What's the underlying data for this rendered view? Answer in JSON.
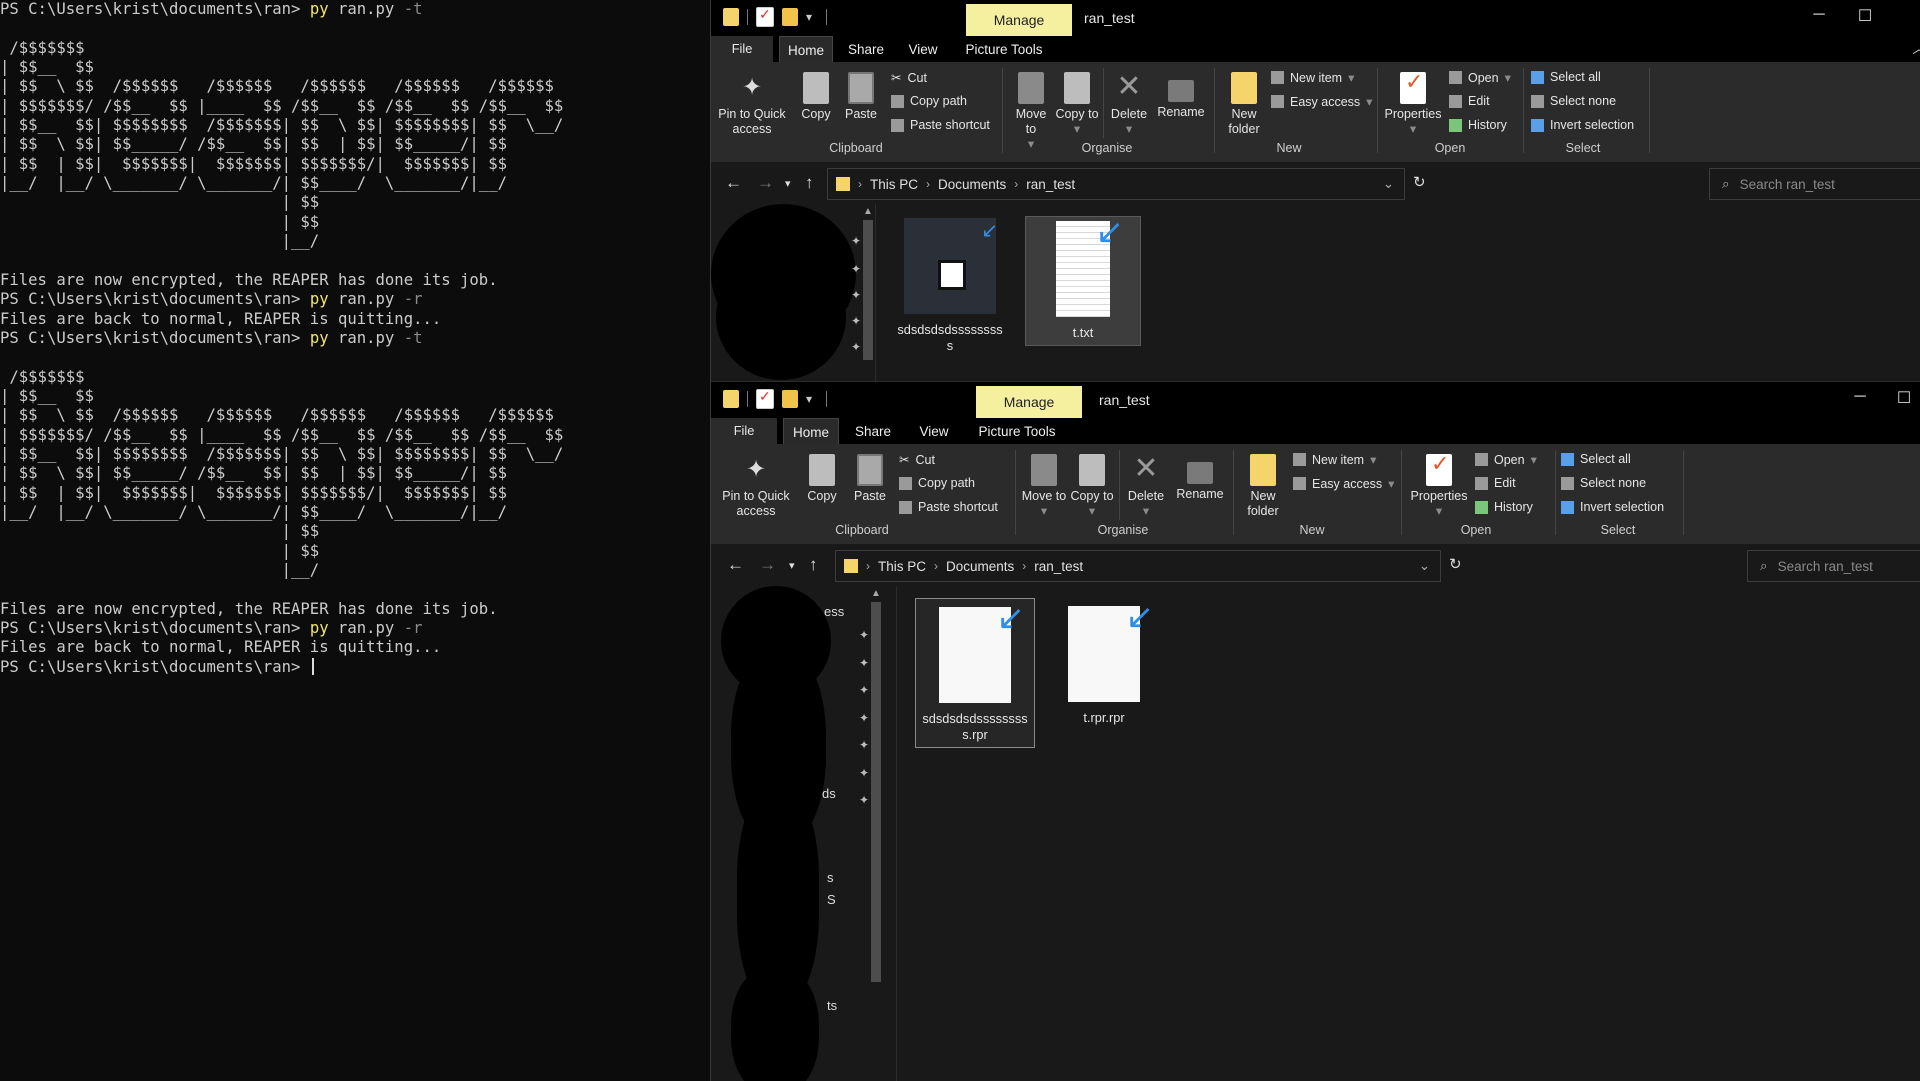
{
  "terminal": {
    "lines": [
      {
        "prompt": "PS C:\\Users\\krist\\documents\\ran> ",
        "cmd": "py",
        "args": " ran.py ",
        "flag": "-t"
      },
      {
        "text": ""
      },
      {
        "text": " /$$$$$$$"
      },
      {
        "text": "| $$__  $$"
      },
      {
        "text": "| $$  \\ $$  /$$$$$$   /$$$$$$   /$$$$$$   /$$$$$$   /$$$$$$"
      },
      {
        "text": "| $$$$$$$/ /$$__  $$ |____  $$ /$$__  $$ /$$__  $$ /$$__  $$"
      },
      {
        "text": "| $$__  $$| $$$$$$$$  /$$$$$$$| $$  \\ $$| $$$$$$$$| $$  \\__/"
      },
      {
        "text": "| $$  \\ $$| $$_____/ /$$__  $$| $$  | $$| $$_____/| $$"
      },
      {
        "text": "| $$  | $$|  $$$$$$$|  $$$$$$$| $$$$$$$/|  $$$$$$$| $$"
      },
      {
        "text": "|__/  |__/ \\_______/ \\_______/| $$____/  \\_______/|__/"
      },
      {
        "text": "                              | $$"
      },
      {
        "text": "                              | $$"
      },
      {
        "text": "                              |__/"
      },
      {
        "text": ""
      },
      {
        "text": "Files are now encrypted, the REAPER has done its job."
      },
      {
        "prompt": "PS C:\\Users\\krist\\documents\\ran> ",
        "cmd": "py",
        "args": " ran.py ",
        "flag": "-r"
      },
      {
        "text": "Files are back to normal, REAPER is quitting..."
      },
      {
        "prompt": "PS C:\\Users\\krist\\documents\\ran> ",
        "cmd": "py",
        "args": " ran.py ",
        "flag": "-t"
      },
      {
        "text": ""
      },
      {
        "text": " /$$$$$$$"
      },
      {
        "text": "| $$__  $$"
      },
      {
        "text": "| $$  \\ $$  /$$$$$$   /$$$$$$   /$$$$$$   /$$$$$$   /$$$$$$"
      },
      {
        "text": "| $$$$$$$/ /$$__  $$ |____  $$ /$$__  $$ /$$__  $$ /$$__  $$"
      },
      {
        "text": "| $$__  $$| $$$$$$$$  /$$$$$$$| $$  \\ $$| $$$$$$$$| $$  \\__/"
      },
      {
        "text": "| $$  \\ $$| $$_____/ /$$__  $$| $$  | $$| $$_____/| $$"
      },
      {
        "text": "| $$  | $$|  $$$$$$$|  $$$$$$$| $$$$$$$/|  $$$$$$$| $$"
      },
      {
        "text": "|__/  |__/ \\_______/ \\_______/| $$____/  \\_______/|__/"
      },
      {
        "text": "                              | $$"
      },
      {
        "text": "                              | $$"
      },
      {
        "text": "                              |__/"
      },
      {
        "text": ""
      },
      {
        "text": "Files are now encrypted, the REAPER has done its job."
      },
      {
        "prompt": "PS C:\\Users\\krist\\documents\\ran> ",
        "cmd": "py",
        "args": " ran.py ",
        "flag": "-r"
      },
      {
        "text": "Files are back to normal, REAPER is quitting..."
      },
      {
        "prompt": "PS C:\\Users\\krist\\documents\\ran> ",
        "cursor": true
      }
    ]
  },
  "explorer": {
    "manage_tab": "Manage",
    "title": "ran_test",
    "tabs": {
      "file": "File",
      "home": "Home",
      "share": "Share",
      "view": "View",
      "picture_tools": "Picture Tools"
    },
    "ribbon": {
      "pin": "Pin to Quick access",
      "copy": "Copy",
      "paste": "Paste",
      "cut": "Cut",
      "copy_path": "Copy path",
      "paste_shortcut": "Paste shortcut",
      "move_to": "Move to",
      "copy_to": "Copy to",
      "delete": "Delete",
      "rename": "Rename",
      "new_folder": "New folder",
      "new_item": "New item",
      "easy_access": "Easy access",
      "properties": "Properties",
      "open": "Open",
      "edit": "Edit",
      "history": "History",
      "select_all": "Select all",
      "select_none": "Select none",
      "invert_selection": "Invert selection",
      "groups": {
        "clipboard": "Clipboard",
        "organise": "Organise",
        "new": "New",
        "open": "Open",
        "select": "Select"
      }
    },
    "breadcrumb": [
      "This PC",
      "Documents",
      "ran_test"
    ],
    "search_placeholder": "Search ran_test"
  },
  "window1": {
    "files": [
      {
        "name": "sdsdsdsdsssssssss",
        "kind": "image"
      },
      {
        "name": "t.txt",
        "kind": "text"
      }
    ]
  },
  "window2": {
    "nav_fragments": [
      "ess",
      "ds",
      "s",
      "S",
      "ts"
    ],
    "files": [
      {
        "name": "sdsdsdsdsssssssss.rpr",
        "kind": "blank"
      },
      {
        "name": "t.rpr.rpr",
        "kind": "blank"
      }
    ]
  },
  "colors": {
    "terminal_bg": "#0c0c0c",
    "command_yellow": "#f2e56b",
    "manage_tab": "#f4f0a0",
    "explorer_bg": "#191919",
    "ribbon_bg": "#2b2b2b"
  }
}
